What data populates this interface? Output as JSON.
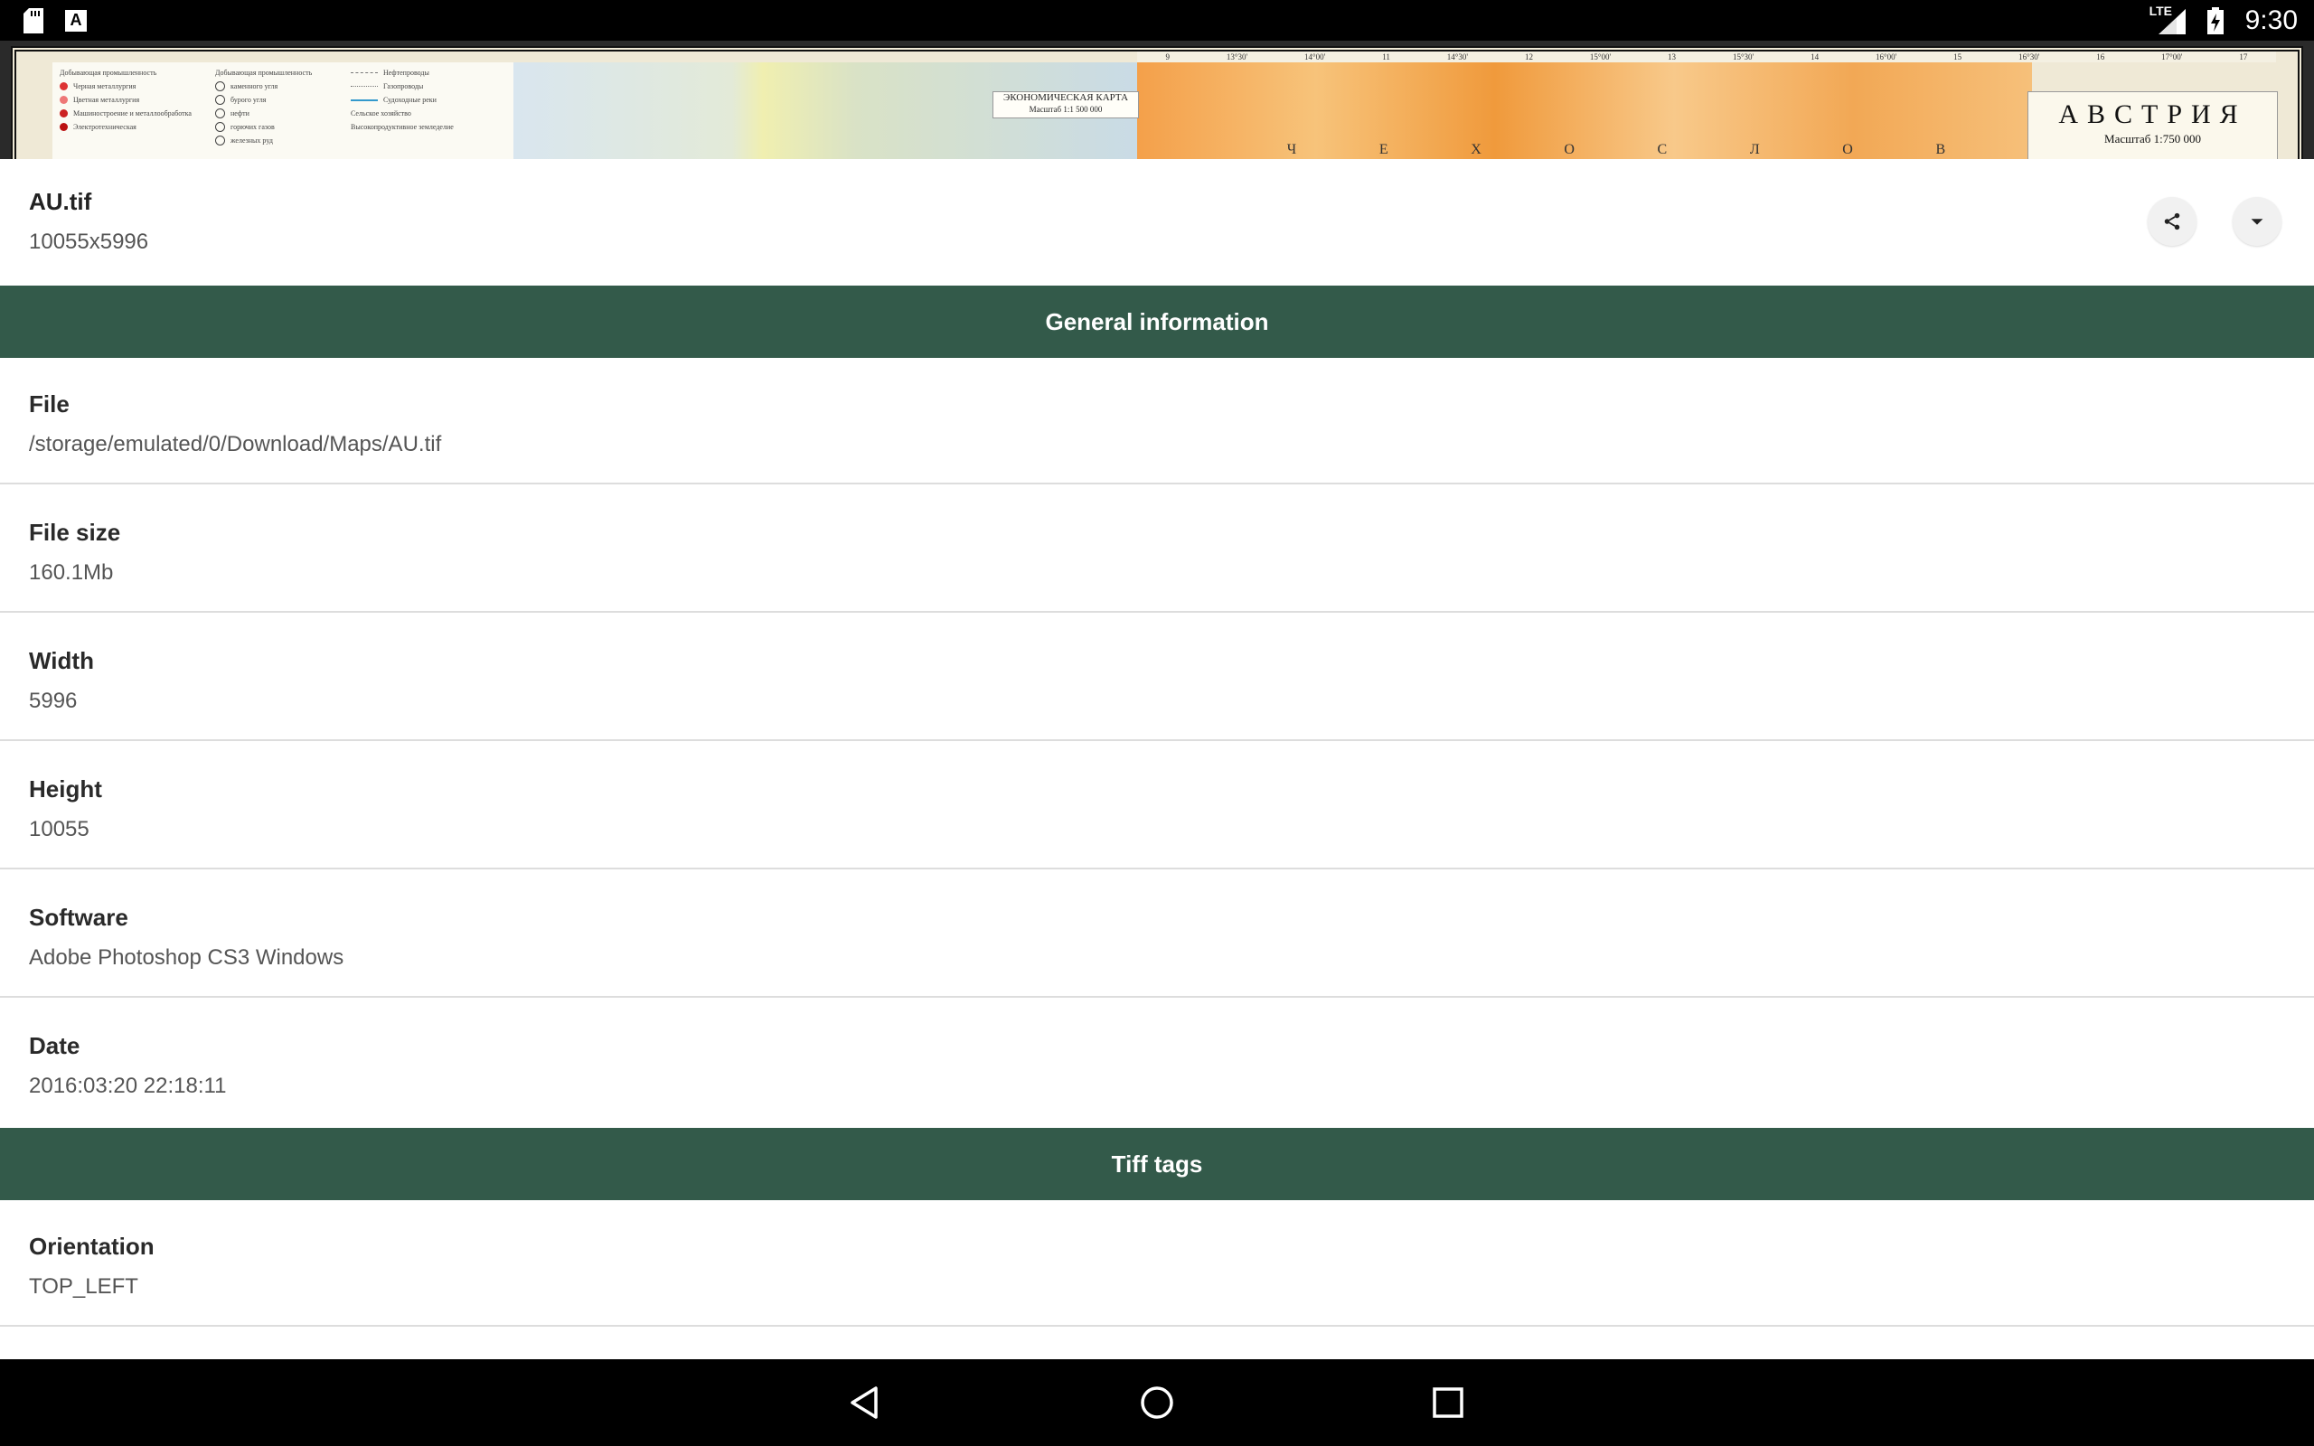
{
  "status_bar": {
    "time": "9:30",
    "network": "LTE",
    "icons": [
      "sd-card-icon",
      "font-a-icon",
      "signal-icon",
      "battery-charging-icon"
    ],
    "letter_icon": "A"
  },
  "map_preview": {
    "title": "АВСТРИЯ",
    "scale": "Масштаб 1:750 000",
    "subtitle": "ЭКОНОМИЧЕСКАЯ КАРТА",
    "subtitle_scale": "Масштаб 1:1 500 000",
    "legend_col1": [
      "Добывающая промышленность",
      "Черная металлургия",
      "Цветная металлургия",
      "Машиностроение и металлообработка",
      "Электротехническая"
    ],
    "legend_col2": [
      "Добывающая промышленность",
      "каменного угля",
      "бурого угля",
      "нефти",
      "горючих газов",
      "железных руд"
    ],
    "legend_col3": [
      "Нефтепроводы",
      "Газопроводы",
      "Судоходные реки",
      "Сельское хозяйство",
      "Высокопродуктивное земледелие"
    ],
    "ticks": [
      "9",
      "13°30'",
      "14°00'",
      "11",
      "14°30'",
      "12",
      "15°00'",
      "13",
      "15°30'",
      "14",
      "16°00'",
      "15",
      "16°30'",
      "16",
      "17°00'",
      "17"
    ],
    "letters": [
      "Ч",
      "Е",
      "Х",
      "О",
      "С",
      "Л",
      "О",
      "В"
    ]
  },
  "header": {
    "file_name": "AU.tif",
    "dimensions": "10055x5996",
    "share_icon": "share-icon",
    "expand_icon": "arrow-drop-down-icon"
  },
  "sections": {
    "general": "General information",
    "tiff": "Tiff tags"
  },
  "rows": {
    "file": {
      "label": "File",
      "value": "/storage/emulated/0/Download/Maps/AU.tif"
    },
    "file_size": {
      "label": "File size",
      "value": "160.1Mb"
    },
    "width": {
      "label": "Width",
      "value": "5996"
    },
    "height": {
      "label": "Height",
      "value": "10055"
    },
    "software": {
      "label": "Software",
      "value": "Adobe Photoshop CS3 Windows"
    },
    "date": {
      "label": "Date",
      "value": "2016:03:20 22:18:11"
    },
    "orientation": {
      "label": "Orientation",
      "value": "TOP_LEFT"
    }
  },
  "nav_bar": {
    "icons": [
      "back-icon",
      "home-icon",
      "recents-icon"
    ]
  },
  "colors": {
    "section_bg": "#335a4a",
    "divider": "#dddddd"
  }
}
